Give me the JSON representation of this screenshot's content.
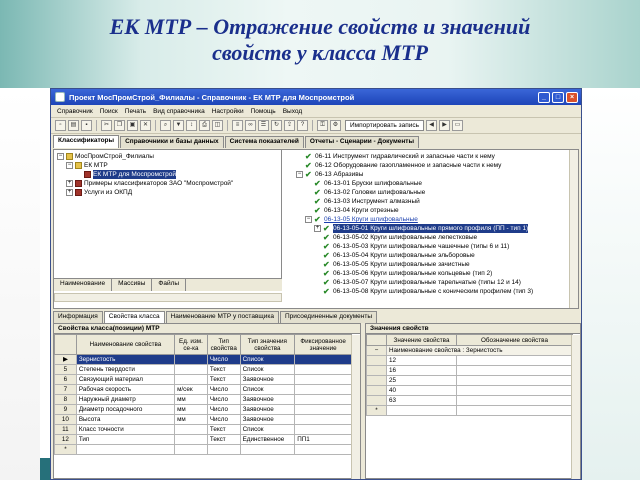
{
  "slide": {
    "title_line1": "ЕК МТР – Отражение свойств и значений",
    "title_line2": "свойств у класса МТР"
  },
  "window": {
    "title": "Проект МосПромСтрой_Филиалы - Справочник - ЕК МТР для Моспромстрой"
  },
  "menu": [
    "Справочник",
    "Поиск",
    "Печать",
    "Вид справочника",
    "Настройки",
    "Помощь",
    "Выход"
  ],
  "toolbar": {
    "import_label": "Импортировать запись"
  },
  "main_tabs": [
    "Классификаторы",
    "Справочники и базы данных",
    "Система показателей",
    "Отчеты - Сценарии - Документы"
  ],
  "left_tree": [
    {
      "label": "МосПромСтрой_Филиалы",
      "level": 0,
      "icon": "folder"
    },
    {
      "label": "ЕК МТР",
      "level": 1,
      "icon": "folder"
    },
    {
      "label": "ЕК МТР для Моспромстрой",
      "level": 2,
      "icon": "book",
      "selected": true
    },
    {
      "label": "Примеры классификаторов ЗАО \"Моспромстрой\"",
      "level": 1,
      "icon": "book"
    },
    {
      "label": "Услуги из ОКПД",
      "level": 1,
      "icon": "book"
    }
  ],
  "left_tabs": [
    "Наименование",
    "Массивы",
    "Файлы"
  ],
  "right_tree": [
    {
      "label": "06-11 Инструмент гидравлический и запасные части к нему",
      "level": 0
    },
    {
      "label": "06-12 Оборудование газопламенное и запасные части к нему",
      "level": 0
    },
    {
      "label": "06-13 Абразивы",
      "level": 0,
      "expanded": true
    },
    {
      "label": "06-13-01 Бруски шлифовальные",
      "level": 1
    },
    {
      "label": "06-13-02 Головки шлифовальные",
      "level": 1
    },
    {
      "label": "06-13-03 Инструмент алмазный",
      "level": 1
    },
    {
      "label": "06-13-04 Круги отрезные",
      "level": 1
    },
    {
      "label": "06-13-05 Круги шлифовальные",
      "level": 1,
      "expanded": true,
      "link": true
    },
    {
      "label": "06-13-05-01 Круги шлифовальные прямого профиля (ПП - тип 1)",
      "level": 2,
      "selected": true
    },
    {
      "label": "06-13-05-02 Круги шлифовальные лепестковые",
      "level": 2
    },
    {
      "label": "06-13-05-03 Круги шлифовальные чашечные (типы 6 и 11)",
      "level": 2
    },
    {
      "label": "06-13-05-04 Круги шлифовальные эльборовые",
      "level": 2
    },
    {
      "label": "06-13-05-05 Круги шлифовальные зачистные",
      "level": 2
    },
    {
      "label": "06-13-05-06 Круги шлифовальные кольцевые (тип 2)",
      "level": 2
    },
    {
      "label": "06-13-05-07 Круги шлифовальные тарельчатые (типы 12 и 14)",
      "level": 2
    },
    {
      "label": "06-13-05-08 Круги шлифовальные с коническим профилем (тип 3)",
      "level": 2
    }
  ],
  "lower_tabs": [
    "Информация",
    "Свойства класса",
    "Наименование МТР у поставщика",
    "Присоединенные документы"
  ],
  "properties": {
    "title": "Свойства класса(позиции) МТР",
    "columns": [
      "Наименование свойства",
      "Ед. изм. се-ка",
      "Тип свойства",
      "Тип значения свойства",
      "Фиксированное значение"
    ],
    "rows": [
      {
        "n": "",
        "name": "Зернистость",
        "unit": "",
        "type": "Число",
        "vtype": "Список",
        "fixed": "",
        "selected": true
      },
      {
        "n": "5",
        "name": "Степень твердости",
        "unit": "",
        "type": "Текст",
        "vtype": "Список",
        "fixed": ""
      },
      {
        "n": "6",
        "name": "Связующий материал",
        "unit": "",
        "type": "Текст",
        "vtype": "Заявочное",
        "fixed": ""
      },
      {
        "n": "7",
        "name": "Рабочая скорость",
        "unit": "м/сек",
        "type": "Число",
        "vtype": "Список",
        "fixed": ""
      },
      {
        "n": "8",
        "name": "Наружный диаметр",
        "unit": "мм",
        "type": "Число",
        "vtype": "Заявочное",
        "fixed": ""
      },
      {
        "n": "9",
        "name": "Диаметр посадочного",
        "unit": "мм",
        "type": "Число",
        "vtype": "Заявочное",
        "fixed": ""
      },
      {
        "n": "10",
        "name": "Высота",
        "unit": "мм",
        "type": "Число",
        "vtype": "Заявочное",
        "fixed": ""
      },
      {
        "n": "11",
        "name": "Класс точности",
        "unit": "",
        "type": "Текст",
        "vtype": "Список",
        "fixed": ""
      },
      {
        "n": "12",
        "name": "Тип",
        "unit": "",
        "type": "Текст",
        "vtype": "Единственное",
        "fixed": "ПП1"
      },
      {
        "n": "*",
        "name": "",
        "unit": "",
        "type": "",
        "vtype": "",
        "fixed": ""
      }
    ]
  },
  "values": {
    "title": "Значения свойств",
    "columns": [
      "Значение свойства",
      "Обозначение свойства"
    ],
    "group_label": "Наименование свойства : Зернистость",
    "rows": [
      {
        "n": "",
        "value": "12",
        "code": ""
      },
      {
        "n": "",
        "value": "16",
        "code": ""
      },
      {
        "n": "",
        "value": "25",
        "code": ""
      },
      {
        "n": "",
        "value": "40",
        "code": ""
      },
      {
        "n": "",
        "value": "63",
        "code": ""
      },
      {
        "n": "*",
        "value": "",
        "code": ""
      }
    ]
  }
}
